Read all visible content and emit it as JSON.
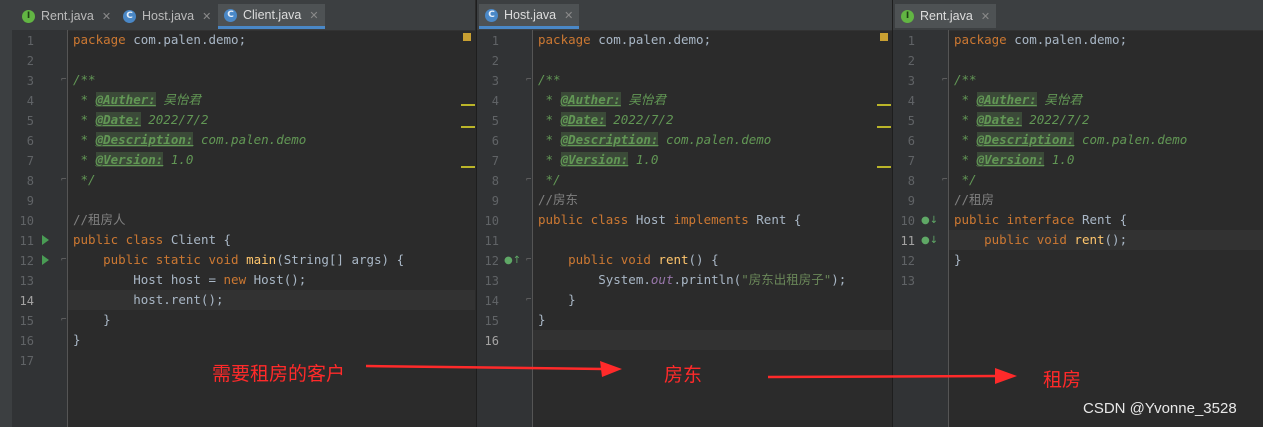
{
  "panes": [
    {
      "tabs": [
        {
          "label": "Rent.java",
          "icon": "interface",
          "active": false
        },
        {
          "label": "Host.java",
          "icon": "class",
          "active": false
        },
        {
          "label": "Client.java",
          "icon": "class",
          "active": true
        }
      ],
      "line_numbers": [
        "1",
        "2",
        "3",
        "4",
        "5",
        "6",
        "7",
        "8",
        "9",
        "10",
        "11",
        "12",
        "13",
        "14",
        "15",
        "16",
        "17"
      ],
      "current_line": "14",
      "code": {
        "l1_kw": "package ",
        "l1_rest": "com.palen.demo;",
        "l3": "/**",
        "l4_star": " * ",
        "l4_tag": "@Auther:",
        "l4_val": " 吴怡君",
        "l5_star": " * ",
        "l5_tag": "@Date:",
        "l5_val": " 2022/7/2",
        "l6_star": " * ",
        "l6_tag": "@Description:",
        "l6_val": " com.palen.demo",
        "l7_star": " * ",
        "l7_tag": "@Version:",
        "l7_val": " 1.0",
        "l8": " */",
        "l10": "//租房人",
        "l11_kw": "public class ",
        "l11_rest": "Client {",
        "l12_kw": "    public static void ",
        "l12_fn": "main",
        "l12_rest": "(String[] args) {",
        "l13_a": "        Host host = ",
        "l13_kw": "new ",
        "l13_b": "Host();",
        "l14": "        host.rent();",
        "l15": "    }",
        "l16": "}"
      }
    },
    {
      "tabs": [
        {
          "label": "Host.java",
          "icon": "class",
          "active": true
        }
      ],
      "line_numbers": [
        "1",
        "2",
        "3",
        "4",
        "5",
        "6",
        "7",
        "8",
        "9",
        "10",
        "11",
        "12",
        "13",
        "14",
        "15",
        "16"
      ],
      "current_line": "16",
      "code": {
        "l1_kw": "package ",
        "l1_rest": "com.palen.demo;",
        "l3": "/**",
        "l4_star": " * ",
        "l4_tag": "@Auther:",
        "l4_val": " 吴怡君",
        "l5_star": " * ",
        "l5_tag": "@Date:",
        "l5_val": " 2022/7/2",
        "l6_star": " * ",
        "l6_tag": "@Description:",
        "l6_val": " com.palen.demo",
        "l7_star": " * ",
        "l7_tag": "@Version:",
        "l7_val": " 1.0",
        "l8": " */",
        "l9": "//房东",
        "l10_kw1": "public class ",
        "l10_a": "Host ",
        "l10_kw2": "implements ",
        "l10_b": "Rent {",
        "l12_kw": "    public void ",
        "l12_fn": "rent",
        "l12_rest": "() {",
        "l13_a": "        System.",
        "l13_sf": "out",
        "l13_b": ".println(",
        "l13_st": "\"房东出租房子\"",
        "l13_c": ");",
        "l14": "    }",
        "l15": "}"
      }
    },
    {
      "tabs": [
        {
          "label": "Rent.java",
          "icon": "interface",
          "active": true
        }
      ],
      "line_numbers": [
        "1",
        "2",
        "3",
        "4",
        "5",
        "6",
        "7",
        "8",
        "9",
        "10",
        "11",
        "12",
        "13"
      ],
      "current_line": "11",
      "code": {
        "l1_kw": "package ",
        "l1_rest": "com.palen.demo;",
        "l3": "/**",
        "l4_star": " * ",
        "l4_tag": "@Auther:",
        "l4_val": " 吴怡君",
        "l5_star": " * ",
        "l5_tag": "@Date:",
        "l5_val": " 2022/7/2",
        "l6_star": " * ",
        "l6_tag": "@Description:",
        "l6_val": " com.palen.demo",
        "l7_star": " * ",
        "l7_tag": "@Version:",
        "l7_val": " 1.0",
        "l8": " */",
        "l9": "//租房",
        "l10_kw": "public interface ",
        "l10_rest": "Rent {",
        "l11_kw": "    public void ",
        "l11_fn": "rent",
        "l11_rest": "();",
        "l12": "}"
      }
    }
  ],
  "annotations": {
    "client": "需要租房的客户",
    "landlord": "房东",
    "rent": "租房"
  },
  "watermark": "CSDN @Yvonne_3528",
  "colors": {
    "annotation": "#ff2a2a",
    "keyword": "#cc7832",
    "comment": "#629755",
    "function": "#ffc66d",
    "string": "#6a8759",
    "background": "#2b2b2b"
  }
}
